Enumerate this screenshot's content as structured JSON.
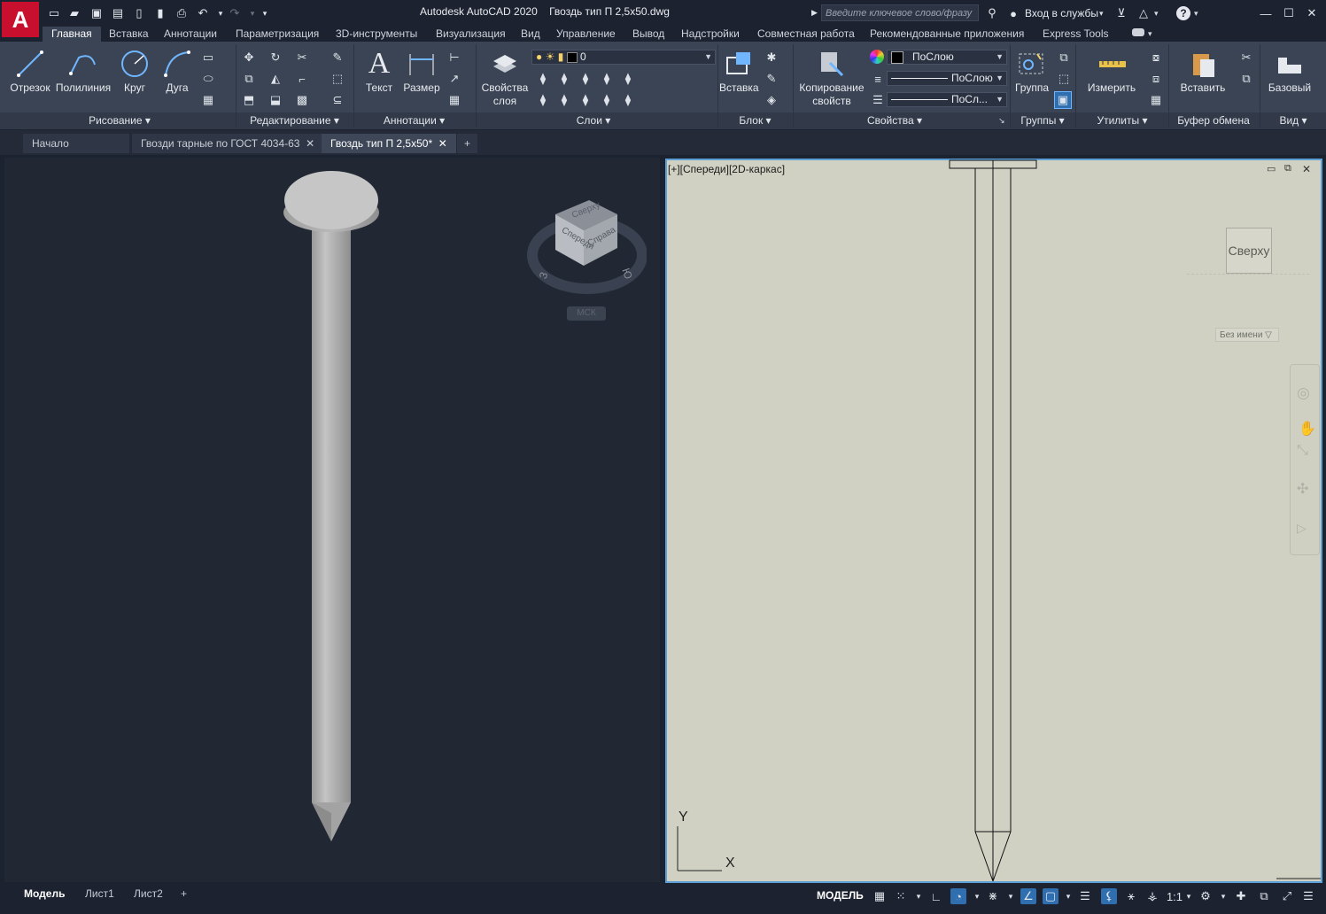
{
  "app": {
    "logo_letter": "A",
    "title": "Autodesk AutoCAD 2020",
    "document": "Гвоздь тип П 2,5х50.dwg",
    "search_placeholder": "Введите ключевое слово/фразу",
    "signin": "Вход в службы",
    "help": "?"
  },
  "menu_tabs": [
    "Главная",
    "Вставка",
    "Аннотации",
    "Параметризация",
    "3D-инструменты",
    "Визуализация",
    "Вид",
    "Управление",
    "Вывод",
    "Надстройки",
    "Совместная работа",
    "Рекомендованные приложения",
    "Express Tools"
  ],
  "ribbon": {
    "draw": {
      "title": "Рисование",
      "line": "Отрезок",
      "polyline": "Полилиния",
      "circle": "Круг",
      "arc": "Дуга"
    },
    "modify": {
      "title": "Редактирование"
    },
    "annotation": {
      "title": "Аннотации",
      "text": "Текст",
      "dimension": "Размер"
    },
    "layers": {
      "title": "Слои",
      "properties": "Свойства слоя",
      "current_layer": "0"
    },
    "block": {
      "title": "Блок",
      "insert": "Вставка"
    },
    "properties": {
      "title": "Свойства",
      "match": "Копирование свойств",
      "color": "ПоСлою",
      "linetype": "ПоСлою",
      "lineweight": "ПоСл..."
    },
    "groups": {
      "title": "Группы",
      "group": "Группа"
    },
    "utilities": {
      "title": "Утилиты",
      "measure": "Измерить"
    },
    "clipboard": {
      "title": "Буфер обмена",
      "paste": "Вставить"
    },
    "view": {
      "title": "Вид",
      "base": "Базовый"
    }
  },
  "file_tabs": [
    {
      "label": "Начало",
      "closable": false,
      "active": false
    },
    {
      "label": "Гвозди тарные по ГОСТ 4034-63",
      "closable": true,
      "active": false
    },
    {
      "label": "Гвоздь тип П 2,5х50*",
      "closable": true,
      "active": true
    }
  ],
  "viewport_left": {
    "viewcube_top": "Сверху",
    "viewcube_front": "Спереди",
    "viewcube_right": "Справа",
    "compass_w": "З",
    "compass_e": "Ю",
    "ucs": "МСК"
  },
  "viewport_right": {
    "label": "[+][Спереди][2D-каркас]",
    "viewcube": "Сверху",
    "named_view": "Без имени",
    "axis_x": "X",
    "axis_y": "Y"
  },
  "layout_tabs": [
    "Модель",
    "Лист1",
    "Лист2"
  ],
  "status": {
    "space": "МОДЕЛЬ",
    "scale": "1:1"
  },
  "colors": {
    "accent": "#5da0d8",
    "logo": "#c8102e",
    "ribbon": "#3b4454",
    "paper": "#d0d1c2"
  }
}
